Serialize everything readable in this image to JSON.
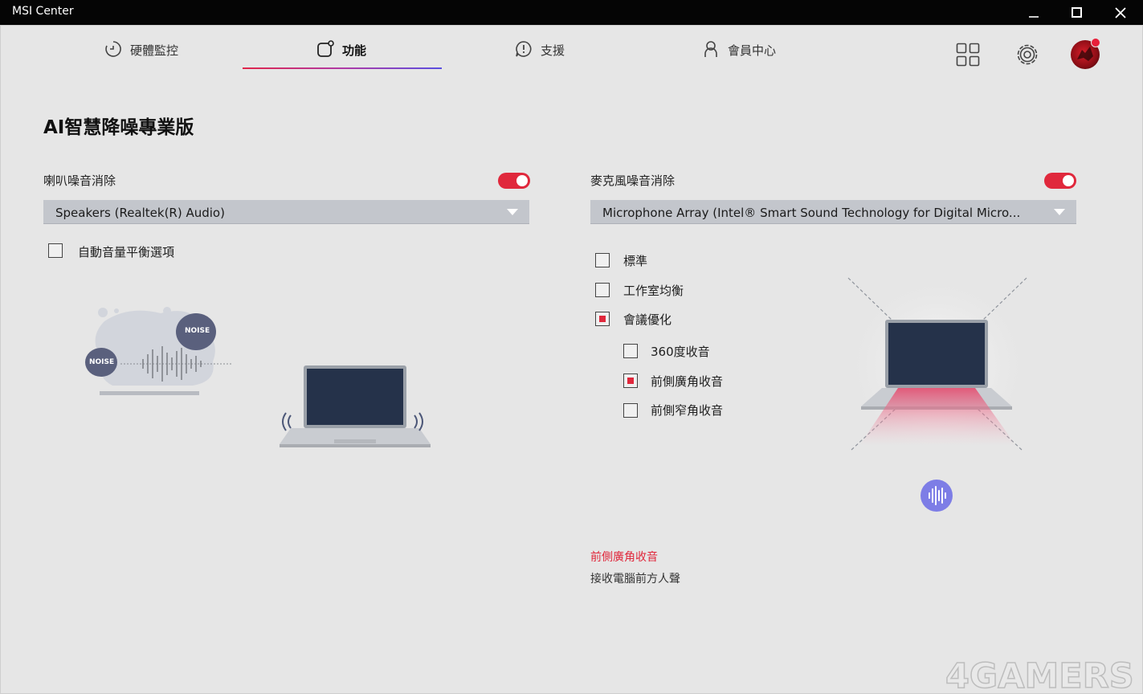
{
  "window": {
    "title": "MSI Center"
  },
  "nav": {
    "tabs": [
      {
        "label": "硬體監控",
        "icon": "hardware-monitor-icon"
      },
      {
        "label": "功能",
        "icon": "features-icon",
        "active": true
      },
      {
        "label": "支援",
        "icon": "support-icon"
      },
      {
        "label": "會員中心",
        "icon": "member-icon"
      }
    ],
    "accent": "#e0264a"
  },
  "page": {
    "title": "AI智慧降噪專業版"
  },
  "speaker": {
    "label": "喇叭噪音消除",
    "enabled": true,
    "device": "Speakers (Realtek(R) Audio)",
    "auto_volume": {
      "label": "自動音量平衡選項",
      "checked": false
    },
    "illustration": {
      "noise_badge_1": "NOISE",
      "noise_badge_2": "NOISE"
    }
  },
  "microphone": {
    "label": "麥克風噪音消除",
    "enabled": true,
    "device": "Microphone Array (Intel® Smart Sound Technology for Digital Micro...",
    "options": [
      {
        "label": "標準",
        "checked": false
      },
      {
        "label": "工作室均衡",
        "checked": false
      },
      {
        "label": "會議優化",
        "checked": true
      }
    ],
    "sub_options": [
      {
        "label": "360度收音",
        "checked": false
      },
      {
        "label": "前側廣角收音",
        "checked": true
      },
      {
        "label": "前側窄角收音",
        "checked": false
      }
    ],
    "selected_mode": {
      "title": "前側廣角收音",
      "description": "接收電腦前方人聲"
    }
  },
  "watermark": "4GAMERS",
  "colors": {
    "toggle_on": "#e0283c",
    "dropdown_bg": "#c3c6cc",
    "mic_badge": "#7d7de6"
  }
}
